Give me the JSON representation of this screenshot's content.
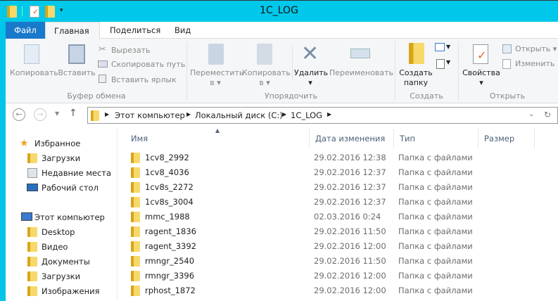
{
  "window": {
    "title": "1C_LOG"
  },
  "tabs": [
    {
      "label": "Файл"
    },
    {
      "label": "Главная"
    },
    {
      "label": "Поделиться"
    },
    {
      "label": "Вид"
    }
  ],
  "ribbon": {
    "clipboard": {
      "label": "Буфер обмена",
      "copy": "Копировать",
      "paste": "Вставить",
      "cut": "Вырезать",
      "copy_path": "Скопировать путь",
      "paste_shortcut": "Вставить ярлык"
    },
    "organize": {
      "label": "Упорядочить",
      "move_to": "Переместить",
      "copy_to": "Копировать",
      "in": "в",
      "delete": "Удалить",
      "rename": "Переименовать"
    },
    "new": {
      "label": "Создать",
      "new_folder_1": "Создать",
      "new_folder_2": "папку"
    },
    "open": {
      "label": "Открыть",
      "properties": "Свойства",
      "open": "Открыть",
      "edit": "Изменить"
    }
  },
  "address": {
    "crumbs": [
      "Этот компьютер",
      "Локальный диск (C:)",
      "1C_LOG"
    ]
  },
  "sidebar": {
    "favorites": "Избранное",
    "fav_items": [
      "Загрузки",
      "Недавние места",
      "Рабочий стол"
    ],
    "computer": "Этот компьютер",
    "pc_items": [
      "Desktop",
      "Видео",
      "Документы",
      "Загрузки",
      "Изображения"
    ]
  },
  "columns": {
    "name": "Имя",
    "date": "Дата изменения",
    "type": "Тип",
    "size": "Размер"
  },
  "files": [
    {
      "name": "1cv8_2992",
      "date": "29.02.2016 12:38",
      "type": "Папка с файлами"
    },
    {
      "name": "1cv8_4036",
      "date": "29.02.2016 12:37",
      "type": "Папка с файлами"
    },
    {
      "name": "1cv8s_2272",
      "date": "29.02.2016 12:37",
      "type": "Папка с файлами"
    },
    {
      "name": "1cv8s_3004",
      "date": "29.02.2016 12:37",
      "type": "Папка с файлами"
    },
    {
      "name": "mmc_1988",
      "date": "02.03.2016 0:24",
      "type": "Папка с файлами"
    },
    {
      "name": "ragent_1836",
      "date": "29.02.2016 11:50",
      "type": "Папка с файлами"
    },
    {
      "name": "ragent_3392",
      "date": "29.02.2016 12:00",
      "type": "Папка с файлами"
    },
    {
      "name": "rmngr_2540",
      "date": "29.02.2016 11:50",
      "type": "Папка с файлами"
    },
    {
      "name": "rmngr_3396",
      "date": "29.02.2016 12:00",
      "type": "Папка с файлами"
    },
    {
      "name": "rphost_1872",
      "date": "29.02.2016 12:00",
      "type": "Папка с файлами"
    }
  ]
}
